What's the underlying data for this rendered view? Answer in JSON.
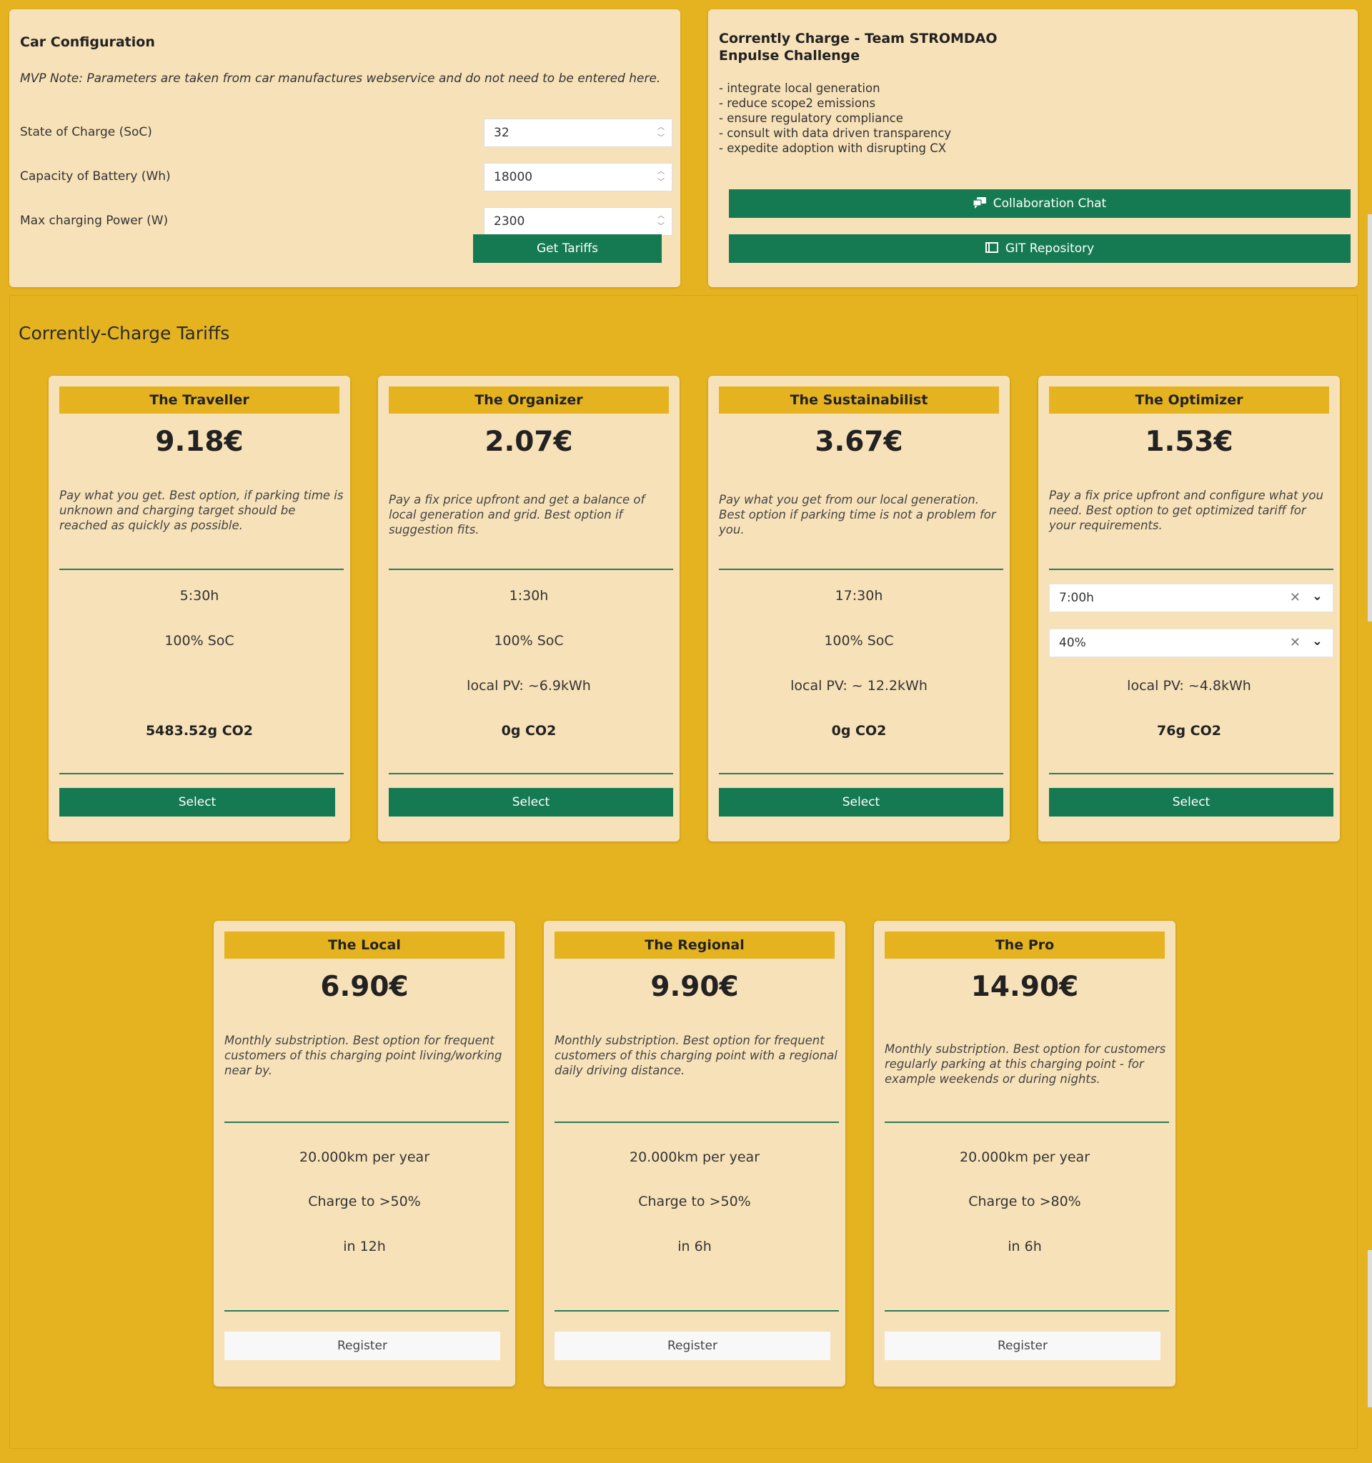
{
  "car_config": {
    "title": "Car Configuration",
    "note": "MVP Note: Parameters are taken from car manufactures webservice and do not need to be entered here.",
    "fields": [
      {
        "label": "State of Charge (SoC)",
        "value": "32"
      },
      {
        "label": "Capacity of Battery (Wh)",
        "value": "18000"
      },
      {
        "label": "Max charging Power (W)",
        "value": "2300"
      }
    ],
    "button": "Get Tariffs"
  },
  "team": {
    "title_line1": "Corrently Charge - Team STROMDAO",
    "title_line2": "Enpulse Challenge",
    "bullets": [
      "- integrate local generation",
      "- reduce scope2 emissions",
      "- ensure regulatory compliance",
      "- consult with data driven transparency",
      "- expedite adoption with disrupting CX"
    ],
    "chat_button": "Collaboration Chat",
    "git_button": "GIT Repository"
  },
  "tariffs": {
    "heading": "Corrently-Charge Tariffs",
    "row1": [
      {
        "name": "The Traveller",
        "price": "9.18€",
        "desc": "Pay what you get. Best option, if parking time is unknown and charging target should be reached as quickly as possible.",
        "time": "5:30h",
        "soc": "100% SoC",
        "pv": "",
        "co2": "5483.52g CO2",
        "button": "Select"
      },
      {
        "name": "The Organizer",
        "price": "2.07€",
        "desc": "Pay a fix price upfront and get a balance of local generation and grid. Best option if suggestion fits.",
        "time": "1:30h",
        "soc": "100% SoC",
        "pv": "local PV: ~6.9kWh",
        "co2": "0g CO2",
        "button": "Select"
      },
      {
        "name": "The Sustainabilist",
        "price": "3.67€",
        "desc": "Pay what you get from our local generation. Best option if parking time is not a problem for you.",
        "time": "17:30h",
        "soc": "100% SoC",
        "pv": "local PV: ~ 12.2kWh",
        "co2": "0g CO2",
        "button": "Select"
      },
      {
        "name": "The Optimizer",
        "price": "1.53€",
        "desc": "Pay a fix price upfront and configure what you need. Best option to get optimized tariff for your requirements.",
        "time_select": "7:00h",
        "soc_select": "40%",
        "pv": "local PV: ~4.8kWh",
        "co2": "76g CO2",
        "button": "Select"
      }
    ],
    "row2": [
      {
        "name": "The Local",
        "price": "6.90€",
        "desc": "Monthly substription. Best option for frequent customers of this charging point living/working near by.",
        "line1": "20.000km per year",
        "line2": "Charge to >50%",
        "line3": "in 12h",
        "button": "Register"
      },
      {
        "name": "The Regional",
        "price": "9.90€",
        "desc": "Monthly substription. Best option for frequent customers of this charging point with a regional daily driving distance.",
        "line1": "20.000km per year",
        "line2": "Charge to >50%",
        "line3": "in 6h",
        "button": "Register"
      },
      {
        "name": "The Pro",
        "price": "14.90€",
        "desc": "Monthly substription. Best option for customers regularly parking at this charging point - for example weekends or during nights.",
        "line1": "20.000km per year",
        "line2": "Charge to >80%",
        "line3": "in 6h",
        "button": "Register"
      }
    ]
  },
  "icons": {
    "chat": "chat-icon",
    "git": "book-icon",
    "clear": "close-icon",
    "chevron": "chevron-down-icon",
    "spinner": "spinner-arrows-icon"
  },
  "colors": {
    "background": "#e5b320",
    "panel": "#f7e1b8",
    "accent_green": "#157a52",
    "register_button": "#f8f8f8"
  }
}
